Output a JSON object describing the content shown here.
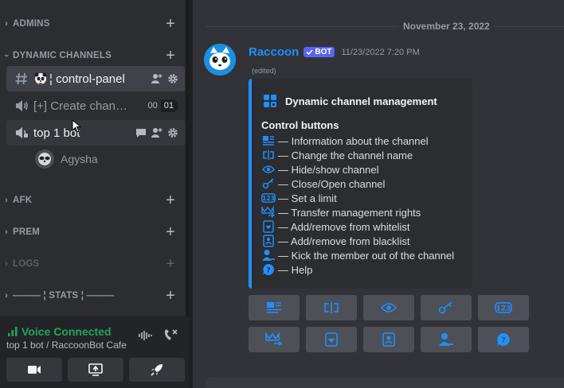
{
  "sidebar": {
    "categories": {
      "admins": "ADMINS",
      "dynamic": "DYNAMIC CHANNELS",
      "afk": "AFK",
      "prem": "PREM",
      "logs": "LOGS",
      "stats": "——— ¦ STATS ¦ ———"
    },
    "channels": {
      "control_panel": "¦ control-panel",
      "create_channel": "[+] Create chan…",
      "create_limit_used": "00",
      "create_limit_max": "01",
      "top_bot": "top 1 bot"
    },
    "voice_member": "Agysha"
  },
  "voice_panel": {
    "status": "Voice Connected",
    "location": "top 1 bot / RaccoonBot Cafe"
  },
  "message": {
    "date_divider": "November 23, 2022",
    "author": "Raccoon",
    "bot_badge": "BOT",
    "timestamp": "11/23/2022 7:20 PM",
    "edited": "(edited)",
    "embed": {
      "title": "Dynamic channel management",
      "subtitle": "Control buttons",
      "lines": [
        "— Information about the channel",
        "— Change the channel name",
        "— Hide/show channel",
        "— Close/Open channel",
        "— Set a limit",
        "— Transfer management rights",
        "— Add/remove from whitelist",
        "— Add/remove from blacklist",
        "— Kick the member out of the channel",
        "— Help"
      ]
    }
  },
  "colors": {
    "accent_blue": "#1e90ff",
    "voice_green": "#23a559",
    "blurple": "#5865f2"
  }
}
